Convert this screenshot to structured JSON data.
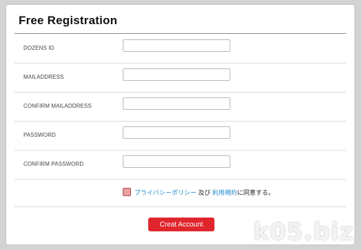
{
  "form": {
    "title": "Free Registration",
    "fields": [
      {
        "label": "DOZENS ID",
        "value": ""
      },
      {
        "label": "MAILADDRESS",
        "value": ""
      },
      {
        "label": "CONFIRM MAILADDRESS",
        "value": ""
      },
      {
        "label": "PASSWORD",
        "value": ""
      },
      {
        "label": "CONFIRM PASSWORD",
        "value": ""
      }
    ],
    "agreement": {
      "privacy_link": "プライバシーポリシー",
      "conjunction": " 及び ",
      "terms_link": "利用規約",
      "suffix": "に同意する。",
      "checked": false
    },
    "submit_label": "Creat Account"
  },
  "watermark": "k05.biz",
  "colors": {
    "accent": "#e0262d",
    "link": "#1e88c8",
    "background": "#d3d3d3"
  }
}
